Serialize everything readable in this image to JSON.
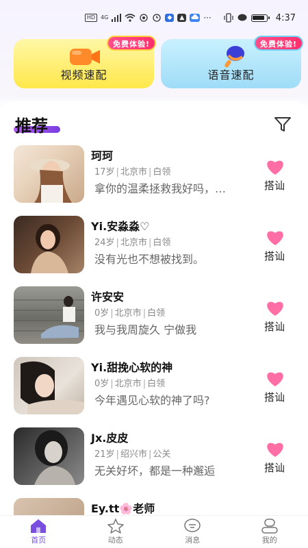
{
  "status_bar": {
    "time": "4:37",
    "hd": "HD",
    "net": "4G"
  },
  "match_cards": {
    "video": {
      "label": "视频速配",
      "badge": "免费体验!"
    },
    "voice": {
      "label": "语音速配",
      "badge": "免费体验!"
    }
  },
  "section": {
    "title": "推荐"
  },
  "users": [
    {
      "name": "珂珂",
      "age": "17岁",
      "city": "北京市",
      "job": "白领",
      "bio": "拿你的温柔拯救我好吗，…",
      "action": "搭讪"
    },
    {
      "name": "Yi.安淼淼♡",
      "age": "24岁",
      "city": "北京市",
      "job": "白领",
      "bio": "没有光也不想被找到。",
      "action": "搭讪"
    },
    {
      "name": "许安安",
      "age": "0岁",
      "city": "北京市",
      "job": "白领",
      "bio": "我与我周旋久 宁做我",
      "action": "搭讪"
    },
    {
      "name": "Yi.甜挽心软的神",
      "age": "0岁",
      "city": "北京市",
      "job": "白领",
      "bio": "今年遇见心软的神了吗?",
      "action": "搭讪"
    },
    {
      "name": "Jx.皮皮",
      "age": "21岁",
      "city": "绍兴市",
      "job": "公关",
      "bio": "无关好坏，都是一种邂逅",
      "action": "搭讪"
    },
    {
      "name": "Ey.tt🌸老师",
      "age": "",
      "city": "",
      "job": "",
      "bio": "",
      "action": ""
    }
  ],
  "nav": [
    {
      "label": "首页",
      "icon": "home-icon"
    },
    {
      "label": "动态",
      "icon": "star-icon"
    },
    {
      "label": "消息",
      "icon": "message-icon"
    },
    {
      "label": "我的",
      "icon": "profile-icon"
    }
  ],
  "colors": {
    "accent": "#7a4fe0",
    "heart": "#ff6fa5",
    "badge": "#ff2f6e"
  }
}
